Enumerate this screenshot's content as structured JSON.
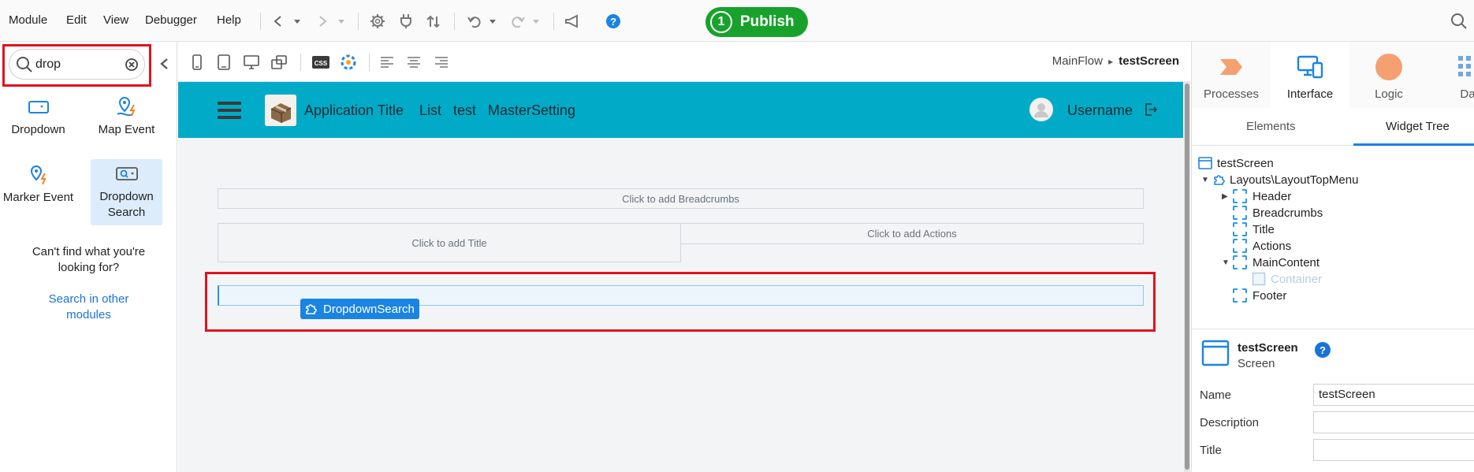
{
  "menu": [
    "Module",
    "Edit",
    "View",
    "Debugger",
    "Help"
  ],
  "publish": {
    "count": "1",
    "label": "Publish"
  },
  "search": {
    "value": "drop"
  },
  "widgets": [
    {
      "label": "Dropdown",
      "icon": "dropdown-icon"
    },
    {
      "label": "Map Event",
      "icon": "map-event-icon"
    },
    {
      "label": "Marker Event",
      "icon": "marker-event-icon"
    },
    {
      "label": "Dropdown Search",
      "icon": "dropdown-search-icon"
    }
  ],
  "help": {
    "text": "Can't find what you're looking for?",
    "link": "Search in other modules"
  },
  "canvas_toolbar": {
    "css_label": "CSS"
  },
  "breadcrumb": {
    "flow": "MainFlow",
    "sep": "▸",
    "screen": "testScreen"
  },
  "app_header": {
    "title": "Application Title",
    "links": [
      "List",
      "test",
      "MasterSetting"
    ],
    "username": "Username"
  },
  "placeholders": {
    "breadcrumbs": "Click to add Breadcrumbs",
    "title": "Click to add Title",
    "actions": "Click to add Actions"
  },
  "drag_chip": "DropdownSearch",
  "right_tabs": [
    {
      "label": "Processes",
      "icon": "processes-icon"
    },
    {
      "label": "Interface",
      "icon": "interface-icon"
    },
    {
      "label": "Logic",
      "icon": "logic-icon"
    },
    {
      "label": "Da",
      "icon": "data-icon"
    }
  ],
  "sub_tabs": [
    "Elements",
    "Widget Tree"
  ],
  "tree": [
    {
      "label": "testScreen"
    },
    {
      "label": "Layouts\\LayoutTopMenu"
    },
    {
      "label": "Header"
    },
    {
      "label": "Breadcrumbs"
    },
    {
      "label": "Title"
    },
    {
      "label": "Actions"
    },
    {
      "label": "MainContent"
    },
    {
      "label": "Container"
    },
    {
      "label": "Footer"
    }
  ],
  "props": {
    "title": "testScreen",
    "subtitle": "Screen",
    "help": "?",
    "fields": [
      {
        "label": "Name",
        "value": "testScreen"
      },
      {
        "label": "Description",
        "value": ""
      },
      {
        "label": "Title",
        "value": ""
      }
    ]
  },
  "colors": {
    "accent": "#1a84e3",
    "header": "#01abc7",
    "publish": "#18a22c",
    "highlight": "#e0131d"
  }
}
